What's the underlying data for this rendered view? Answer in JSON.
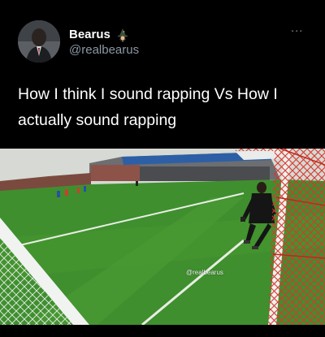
{
  "tweet": {
    "display_name": "Bearus",
    "handle": "@realbearus",
    "more_label": "···",
    "text": "How I think I sound rapping Vs How I actually sound rapping",
    "badge_icon": "wizard-emoji-icon"
  },
  "media": {
    "watermark": "@realbearus",
    "description_icons": [
      "soccer-goal-net",
      "goalkeeper"
    ]
  },
  "colors": {
    "background": "#000000",
    "text": "#ffffff",
    "secondary_text": "#8b98a5",
    "pitch_green": "#3f8f2f",
    "net_red": "#d8382c"
  }
}
